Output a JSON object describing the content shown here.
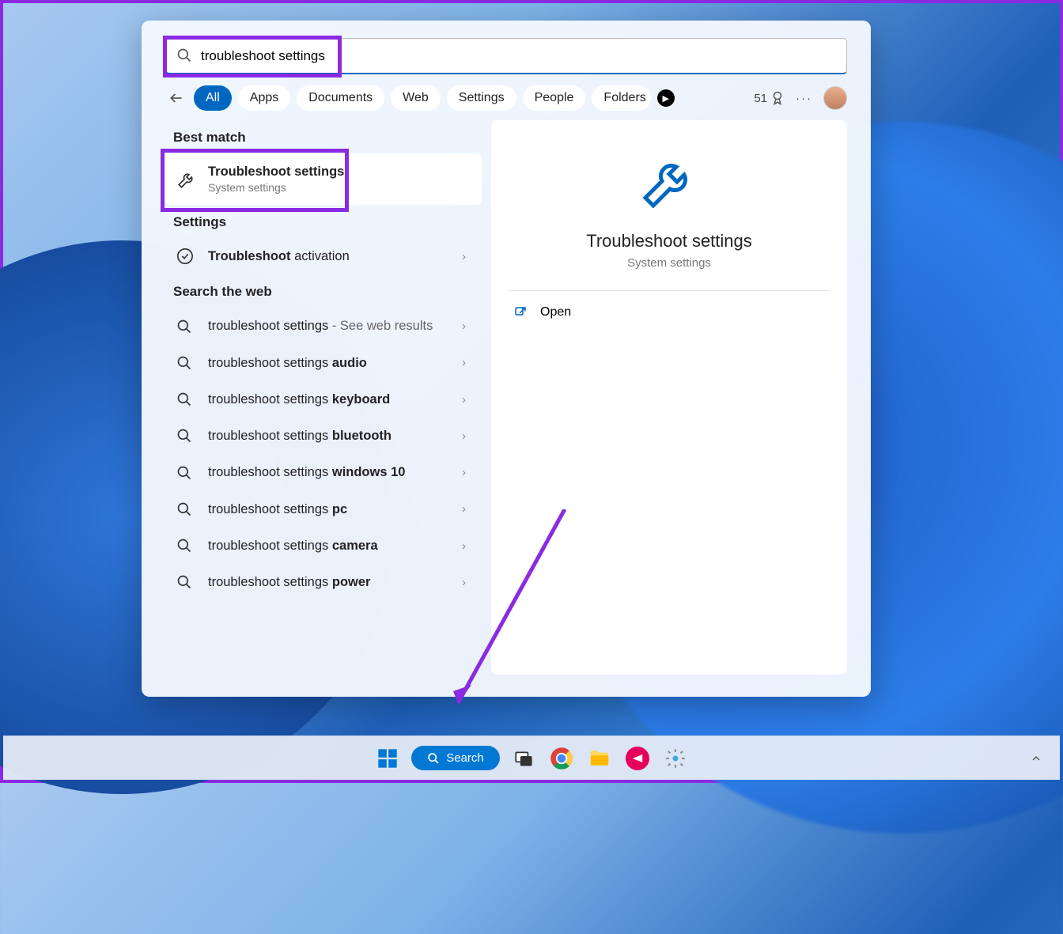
{
  "search": {
    "query": "troubleshoot settings"
  },
  "tabs": {
    "items": [
      "All",
      "Apps",
      "Documents",
      "Web",
      "Settings",
      "People",
      "Folders"
    ],
    "active_index": 0
  },
  "header_right": {
    "points": "51"
  },
  "left": {
    "best_match_label": "Best match",
    "best_match": {
      "title": "Troubleshoot settings",
      "subtitle": "System settings"
    },
    "settings_label": "Settings",
    "settings_items": [
      {
        "prefix_bold": "Troubleshoot",
        "suffix": " activation"
      }
    ],
    "web_label": "Search the web",
    "web_items": [
      {
        "prefix": "troubleshoot settings",
        "suffix": " - See web results"
      },
      {
        "prefix": "troubleshoot settings ",
        "suffix_bold": "audio"
      },
      {
        "prefix": "troubleshoot settings ",
        "suffix_bold": "keyboard"
      },
      {
        "prefix": "troubleshoot settings ",
        "suffix_bold": "bluetooth"
      },
      {
        "prefix": "troubleshoot settings ",
        "suffix_bold": "windows 10"
      },
      {
        "prefix": "troubleshoot settings ",
        "suffix_bold": "pc"
      },
      {
        "prefix": "troubleshoot settings ",
        "suffix_bold": "camera"
      },
      {
        "prefix": "troubleshoot settings ",
        "suffix_bold": "power"
      }
    ]
  },
  "preview": {
    "title": "Troubleshoot settings",
    "subtitle": "System settings",
    "actions": [
      {
        "label": "Open"
      }
    ]
  },
  "taskbar": {
    "search_label": "Search"
  },
  "annotation": {
    "highlight_color": "#8a2be2"
  }
}
